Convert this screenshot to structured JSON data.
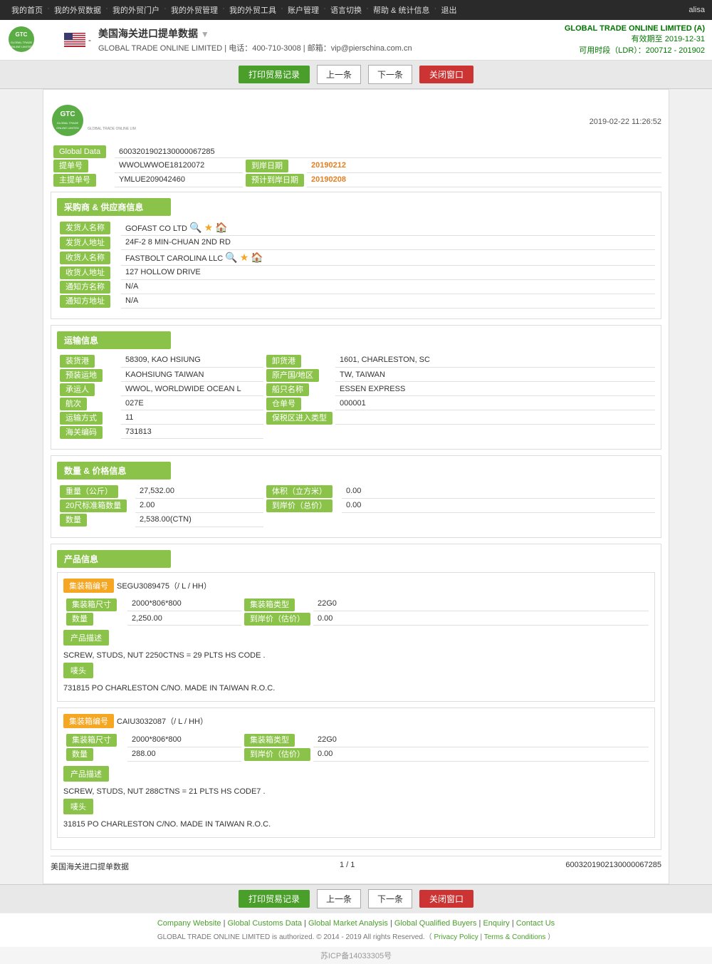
{
  "topnav": {
    "items": [
      "我的首页",
      "我的外贸数据",
      "我的外贸门户",
      "我的外贸管理",
      "我的外贸工具",
      "账户管理",
      "语言切换",
      "帮助 & 统计信息",
      "退出"
    ],
    "user": "alisa"
  },
  "header": {
    "title": "美国海关进口提单数据",
    "company": "GLOBAL TRADE ONLINE LIMITED",
    "phone": "电话：400-710-3008",
    "email": "邮箱：vip@pierschina.com.cn",
    "right_company": "GLOBAL TRADE ONLINE LIMITED (A)",
    "valid_until": "有效期至 2019-12-31",
    "ldr": "可用时段（LDR）：200712 - 201902"
  },
  "toolbar": {
    "print_btn": "打印贸易记录",
    "prev_btn": "上一条",
    "next_btn": "下一条",
    "close_btn": "关闭窗口"
  },
  "document": {
    "datetime": "2019-02-22 11:26:52",
    "global_data_label": "Global Data",
    "global_data_value": "6003201902130000067285",
    "bill_label": "提单号",
    "bill_value": "WWOLWWOE18120072",
    "arrival_date_label": "到岸日期",
    "arrival_date_value": "20190212",
    "master_bill_label": "主提单号",
    "master_bill_value": "YMLUE209042460",
    "estimated_date_label": "预计到岸日期",
    "estimated_date_value": "20190208"
  },
  "buyer_section": {
    "title": "采购商 & 供应商信息",
    "shipper_name_label": "发货人名称",
    "shipper_name_value": "GOFAST CO LTD",
    "shipper_addr_label": "发货人地址",
    "shipper_addr_value": "24F-2 8 MIN-CHUAN 2ND RD",
    "consignee_name_label": "收货人名称",
    "consignee_name_value": "FASTBOLT CAROLINA LLC",
    "consignee_addr_label": "收货人地址",
    "consignee_addr_value": "127 HOLLOW DRIVE",
    "notify_name_label": "通知方名称",
    "notify_name_value": "N/A",
    "notify_addr_label": "通知方地址",
    "notify_addr_value": "N/A"
  },
  "transport_section": {
    "title": "运输信息",
    "loading_port_label": "装货港",
    "loading_port_value": "58309, KAO HSIUNG",
    "discharge_port_label": "卸货港",
    "discharge_port_value": "1601, CHARLESTON, SC",
    "pre_loading_label": "预装运地",
    "pre_loading_value": "KAOHSIUNG TAIWAN",
    "origin_country_label": "原产国/地区",
    "origin_country_value": "TW, TAIWAN",
    "carrier_label": "承运人",
    "carrier_value": "WWOL, WORLDWIDE OCEAN L",
    "vessel_label": "船只名称",
    "vessel_value": "ESSEN EXPRESS",
    "voyage_label": "航次",
    "voyage_value": "027E",
    "manifest_label": "仓单号",
    "manifest_value": "000001",
    "transport_mode_label": "运输方式",
    "transport_mode_value": "11",
    "bonded_label": "保税区进入类型",
    "bonded_value": "",
    "customs_label": "海关编码",
    "customs_value": "731813"
  },
  "quantity_section": {
    "title": "数量 & 价格信息",
    "weight_label": "重量（公斤）",
    "weight_value": "27,532.00",
    "volume_label": "体积（立方米）",
    "volume_value": "0.00",
    "container20_label": "20尺标准箱数量",
    "container20_value": "2.00",
    "arrival_price_label": "到岸价（总价）",
    "arrival_price_value": "0.00",
    "quantity_label": "数量",
    "quantity_value": "2,538.00(CTN)"
  },
  "product_section": {
    "title": "产品信息",
    "container1": {
      "badge": "集装箱编号",
      "badge_value": "SEGU3089475（/ L / HH）",
      "size_label": "集装箱尺寸",
      "size_value": "2000*806*800",
      "type_label": "集装箱类型",
      "type_value": "22G0",
      "quantity_label": "数量",
      "quantity_value": "2,250.00",
      "arrival_price_label": "到岸价（估价）",
      "arrival_price_value": "0.00",
      "desc_label": "产品描述",
      "desc_text": "SCREW, STUDS, NUT 2250CTNS = 29 PLTS HS CODE .",
      "marks_label": "唛头",
      "marks_text": "731815 PO CHARLESTON C/NO. MADE IN TAIWAN R.O.C."
    },
    "container2": {
      "badge": "集装箱编号",
      "badge_value": "CAIU3032087（/ L / HH）",
      "size_label": "集装箱尺寸",
      "size_value": "2000*806*800",
      "type_label": "集装箱类型",
      "type_value": "22G0",
      "quantity_label": "数量",
      "quantity_value": "288.00",
      "arrival_price_label": "到岸价（估价）",
      "arrival_price_value": "0.00",
      "desc_label": "产品描述",
      "desc_text": "SCREW, STUDS, NUT 288CTNS = 21 PLTS HS CODE7 .",
      "marks_label": "唛头",
      "marks_text": "31815 PO CHARLESTON C/NO. MADE IN TAIWAN R.O.C."
    }
  },
  "footer_doc": {
    "source": "美国海关进口提单数据",
    "page": "1 / 1",
    "record_id": "6003201902130000067285"
  },
  "footer_links": {
    "items": [
      "Company Website",
      "Global Customs Data",
      "Global Market Analysis",
      "Global Qualified Buyers",
      "Enquiry",
      "Contact Us"
    ],
    "copyright": "GLOBAL TRADE ONLINE LIMITED is authorized. © 2014 - 2019 All rights Reserved.（",
    "privacy": "Privacy Policy",
    "terms": "Terms & Conditions",
    "copyright_end": "）"
  },
  "icp": "苏ICP备14033305号",
  "logo_text": "GLOBAL TRADE ONLINE LIMITED"
}
